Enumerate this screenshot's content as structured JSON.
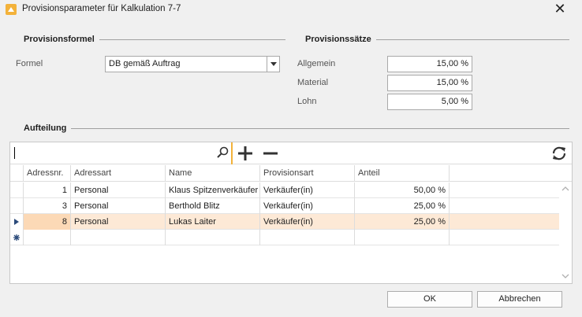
{
  "window": {
    "title": "Provisionsparameter für Kalkulation 7-7"
  },
  "provisionsformel": {
    "heading": "Provisionsformel",
    "formel_label": "Formel",
    "formel_value": "DB gemäß Auftrag"
  },
  "provisionssaetze": {
    "heading": "Provisionssätze",
    "allgemein_label": "Allgemein",
    "allgemein_value": "15,00 %",
    "material_label": "Material",
    "material_value": "15,00 %",
    "lohn_label": "Lohn",
    "lohn_value": "5,00 %"
  },
  "aufteilung": {
    "heading": "Aufteilung",
    "search_value": "",
    "columns": [
      "Adressnr.",
      "Adressart",
      "Name",
      "Provisionsart",
      "Anteil"
    ],
    "rows": [
      {
        "adressnr": "1",
        "adressart": "Personal",
        "name": "Klaus Spitzenverkäufer",
        "provisionsart": "Verkäufer(in)",
        "anteil": "50,00 %"
      },
      {
        "adressnr": "3",
        "adressart": "Personal",
        "name": "Berthold Blitz",
        "provisionsart": "Verkäufer(in)",
        "anteil": "25,00 %"
      },
      {
        "adressnr": "8",
        "adressart": "Personal",
        "name": "Lukas Laiter",
        "provisionsart": "Verkäufer(in)",
        "anteil": "25,00 %"
      }
    ],
    "selected_row": 2
  },
  "buttons": {
    "ok": "OK",
    "cancel": "Abbrechen"
  },
  "icons": {
    "app": "app-icon",
    "close": "close-icon",
    "search": "search-icon",
    "add": "plus-icon",
    "remove": "minus-icon",
    "refresh": "refresh-icon",
    "row_indicator": "row-pointer-icon",
    "new_row": "new-row-icon"
  },
  "colors": {
    "accent": "#f3b23a",
    "selected_row": "#fde9d6"
  }
}
